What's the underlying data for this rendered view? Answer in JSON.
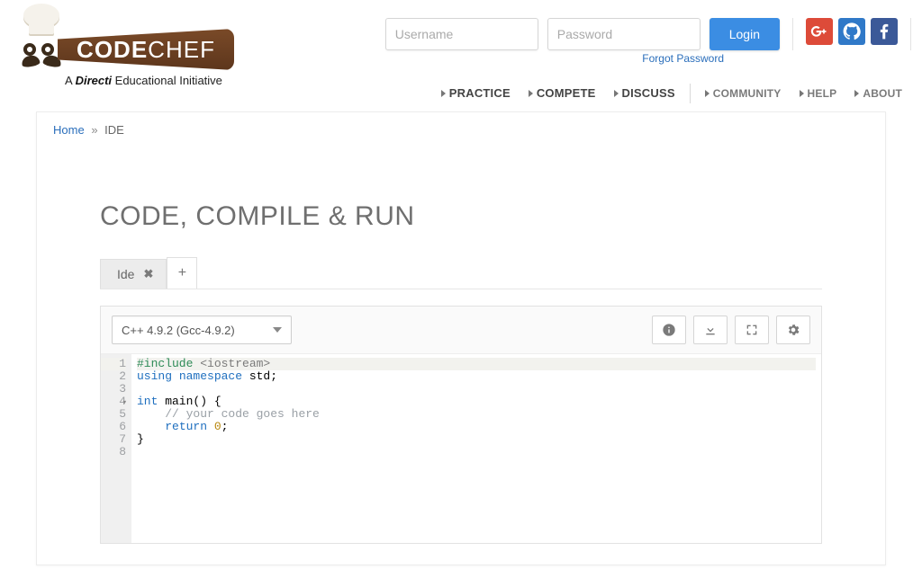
{
  "brand": {
    "code": "CODE",
    "chef": "CHEF"
  },
  "tagline": {
    "prefix": "A ",
    "brand": "Directi",
    "suffix": " Educational Initiative"
  },
  "auth": {
    "username_placeholder": "Username",
    "password_placeholder": "Password",
    "login_label": "Login",
    "forgot_label": "Forgot Password"
  },
  "nav": {
    "practice": "PRACTICE",
    "compete": "COMPETE",
    "discuss": "DISCUSS",
    "community": "COMMUNITY",
    "help": "HELP",
    "about": "ABOUT"
  },
  "breadcrumb": {
    "home": "Home",
    "sep": "»",
    "current": "IDE"
  },
  "page": {
    "title": "CODE, COMPILE & RUN"
  },
  "tabs": {
    "active": "Ide",
    "close_glyph": "✖",
    "add_glyph": "+"
  },
  "toolbar": {
    "language": "C++ 4.9.2 (Gcc-4.9.2)"
  },
  "code": {
    "l1": {
      "a": "#include ",
      "b": "<iostream>"
    },
    "l2": {
      "a": "using ",
      "b": "namespace",
      "c": " std;"
    },
    "l3": "",
    "l4": {
      "a": "int",
      "b": " main() {"
    },
    "l5": {
      "indent": "    ",
      "cmt": "// your code goes here"
    },
    "l6": {
      "indent": "    ",
      "a": "return ",
      "n": "0",
      "b": ";"
    },
    "l7": "}",
    "l8": ""
  },
  "gutter": {
    "l1": "1",
    "l2": "2",
    "l3": "3",
    "l4": "4",
    "l5": "5",
    "l6": "6",
    "l7": "7",
    "l8": "8",
    "fold": "▾"
  }
}
